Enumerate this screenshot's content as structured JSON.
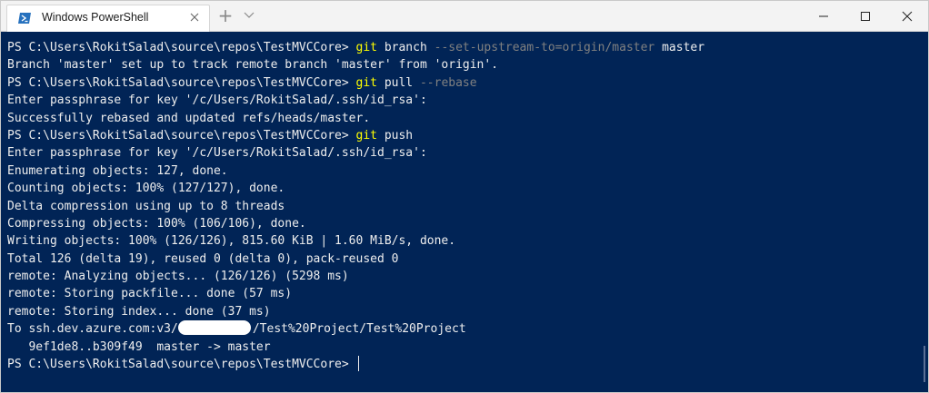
{
  "window": {
    "tab_title": "Windows PowerShell",
    "new_tab": "+"
  },
  "prompt": "PS C:\\Users\\RokitSalad\\source\\repos\\TestMVCCore> ",
  "commands": {
    "c1_cmd": "git",
    "c1_arg": "branch",
    "c1_param": "--set-upstream-to=origin/master",
    "c1_arg2": "master",
    "c2_cmd": "git",
    "c2_arg": "pull",
    "c2_param": "--rebase",
    "c3_cmd": "git",
    "c3_arg": "push"
  },
  "output": {
    "l2": "Branch 'master' set up to track remote branch 'master' from 'origin'.",
    "l4": "Enter passphrase for key '/c/Users/RokitSalad/.ssh/id_rsa':",
    "l5": "Successfully rebased and updated refs/heads/master.",
    "l7": "Enter passphrase for key '/c/Users/RokitSalad/.ssh/id_rsa':",
    "l8": "Enumerating objects: 127, done.",
    "l9": "Counting objects: 100% (127/127), done.",
    "l10": "Delta compression using up to 8 threads",
    "l11": "Compressing objects: 100% (106/106), done.",
    "l12": "Writing objects: 100% (126/126), 815.60 KiB | 1.60 MiB/s, done.",
    "l13": "Total 126 (delta 19), reused 0 (delta 0), pack-reused 0",
    "l14": "remote: Analyzing objects... (126/126) (5298 ms)",
    "l15": "remote: Storing packfile... done (57 ms)",
    "l16": "remote: Storing index... done (37 ms)",
    "l17a": "To ssh.dev.azure.com:v3/",
    "l17b": "/Test%20Project/Test%20Project",
    "l18": "   9ef1de8..b309f49  master -> master"
  },
  "colors": {
    "background": "#012456",
    "text": "#eeeeee",
    "command": "#ffff00",
    "parameter": "#808080"
  },
  "icons": {
    "tab": "powershell-icon",
    "close": "close-icon",
    "dropdown": "chevron-down-icon"
  }
}
